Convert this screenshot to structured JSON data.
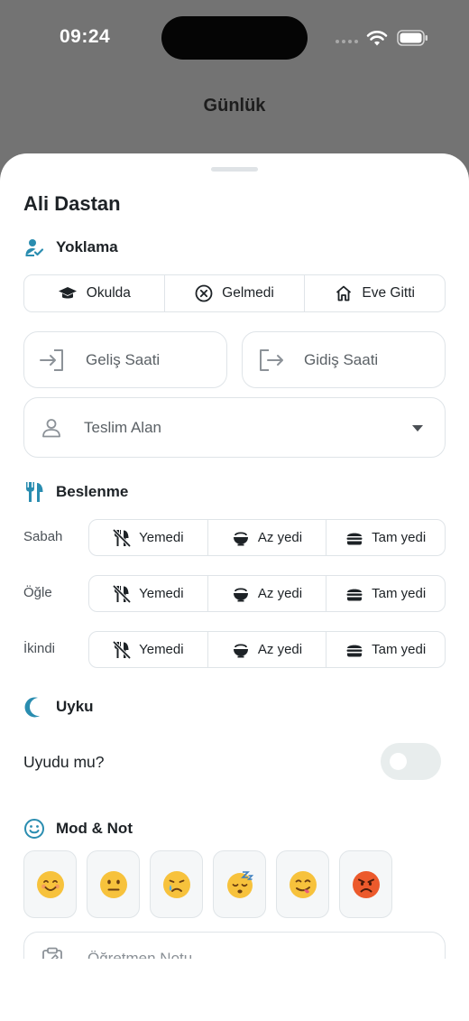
{
  "status_bar": {
    "time": "09:24"
  },
  "header": {
    "title": "Günlük"
  },
  "child": {
    "name": "Ali Dastan"
  },
  "attendance": {
    "title": "Yoklama",
    "options": [
      "Okulda",
      "Gelmedi",
      "Eve Gitti"
    ],
    "arrival_placeholder": "Geliş Saati",
    "departure_placeholder": "Gidiş Saati",
    "pickup_placeholder": "Teslim Alan"
  },
  "nutrition": {
    "title": "Beslenme",
    "meals": [
      {
        "label": "Sabah",
        "options": [
          "Yemedi",
          "Az yedi",
          "Tam yedi"
        ]
      },
      {
        "label": "Öğle",
        "options": [
          "Yemedi",
          "Az yedi",
          "Tam yedi"
        ]
      },
      {
        "label": "İkindi",
        "options": [
          "Yemedi",
          "Az yedi",
          "Tam yedi"
        ]
      }
    ]
  },
  "sleep": {
    "title": "Uyku",
    "question": "Uyudu mu?",
    "value": false
  },
  "mood": {
    "title": "Mod & Not",
    "emojis": [
      "😊",
      "😐",
      "😢",
      "😴",
      "🤤",
      "😡"
    ],
    "note_placeholder": "Öğretmen Notu"
  },
  "colors": {
    "accent": "#2a8db0",
    "border": "#dfe4e8",
    "dim_overlay": "#737373"
  },
  "icons": {
    "attendance": "person-check-icon",
    "nutrition": "fork-knife-icon",
    "sleep": "moon-icon",
    "mood": "smile-icon"
  }
}
